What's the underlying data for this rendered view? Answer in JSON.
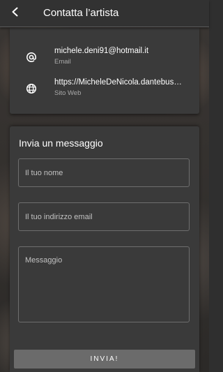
{
  "header": {
    "title": "Contatta l’artista",
    "back_icon": "arrow-left-icon"
  },
  "contacts": [
    {
      "icon": "at-sign-icon",
      "value": "michele.deni91@hotmail.it",
      "label": "Email"
    },
    {
      "icon": "globe-icon",
      "value": "https://MicheleDeNicola.dantebus.com",
      "label": "Sito Web"
    }
  ],
  "message_form": {
    "title": "Invia un messaggio",
    "name_placeholder": "Il tuo nome",
    "email_placeholder": "Il tuo indirizzo email",
    "message_placeholder": "Messaggio",
    "send_label": "INVIA!"
  },
  "colors": {
    "card": "#3a3a3a",
    "topbar": "#323232",
    "button": "#6b6b6b",
    "secondary_text": "#a9a9a9"
  }
}
